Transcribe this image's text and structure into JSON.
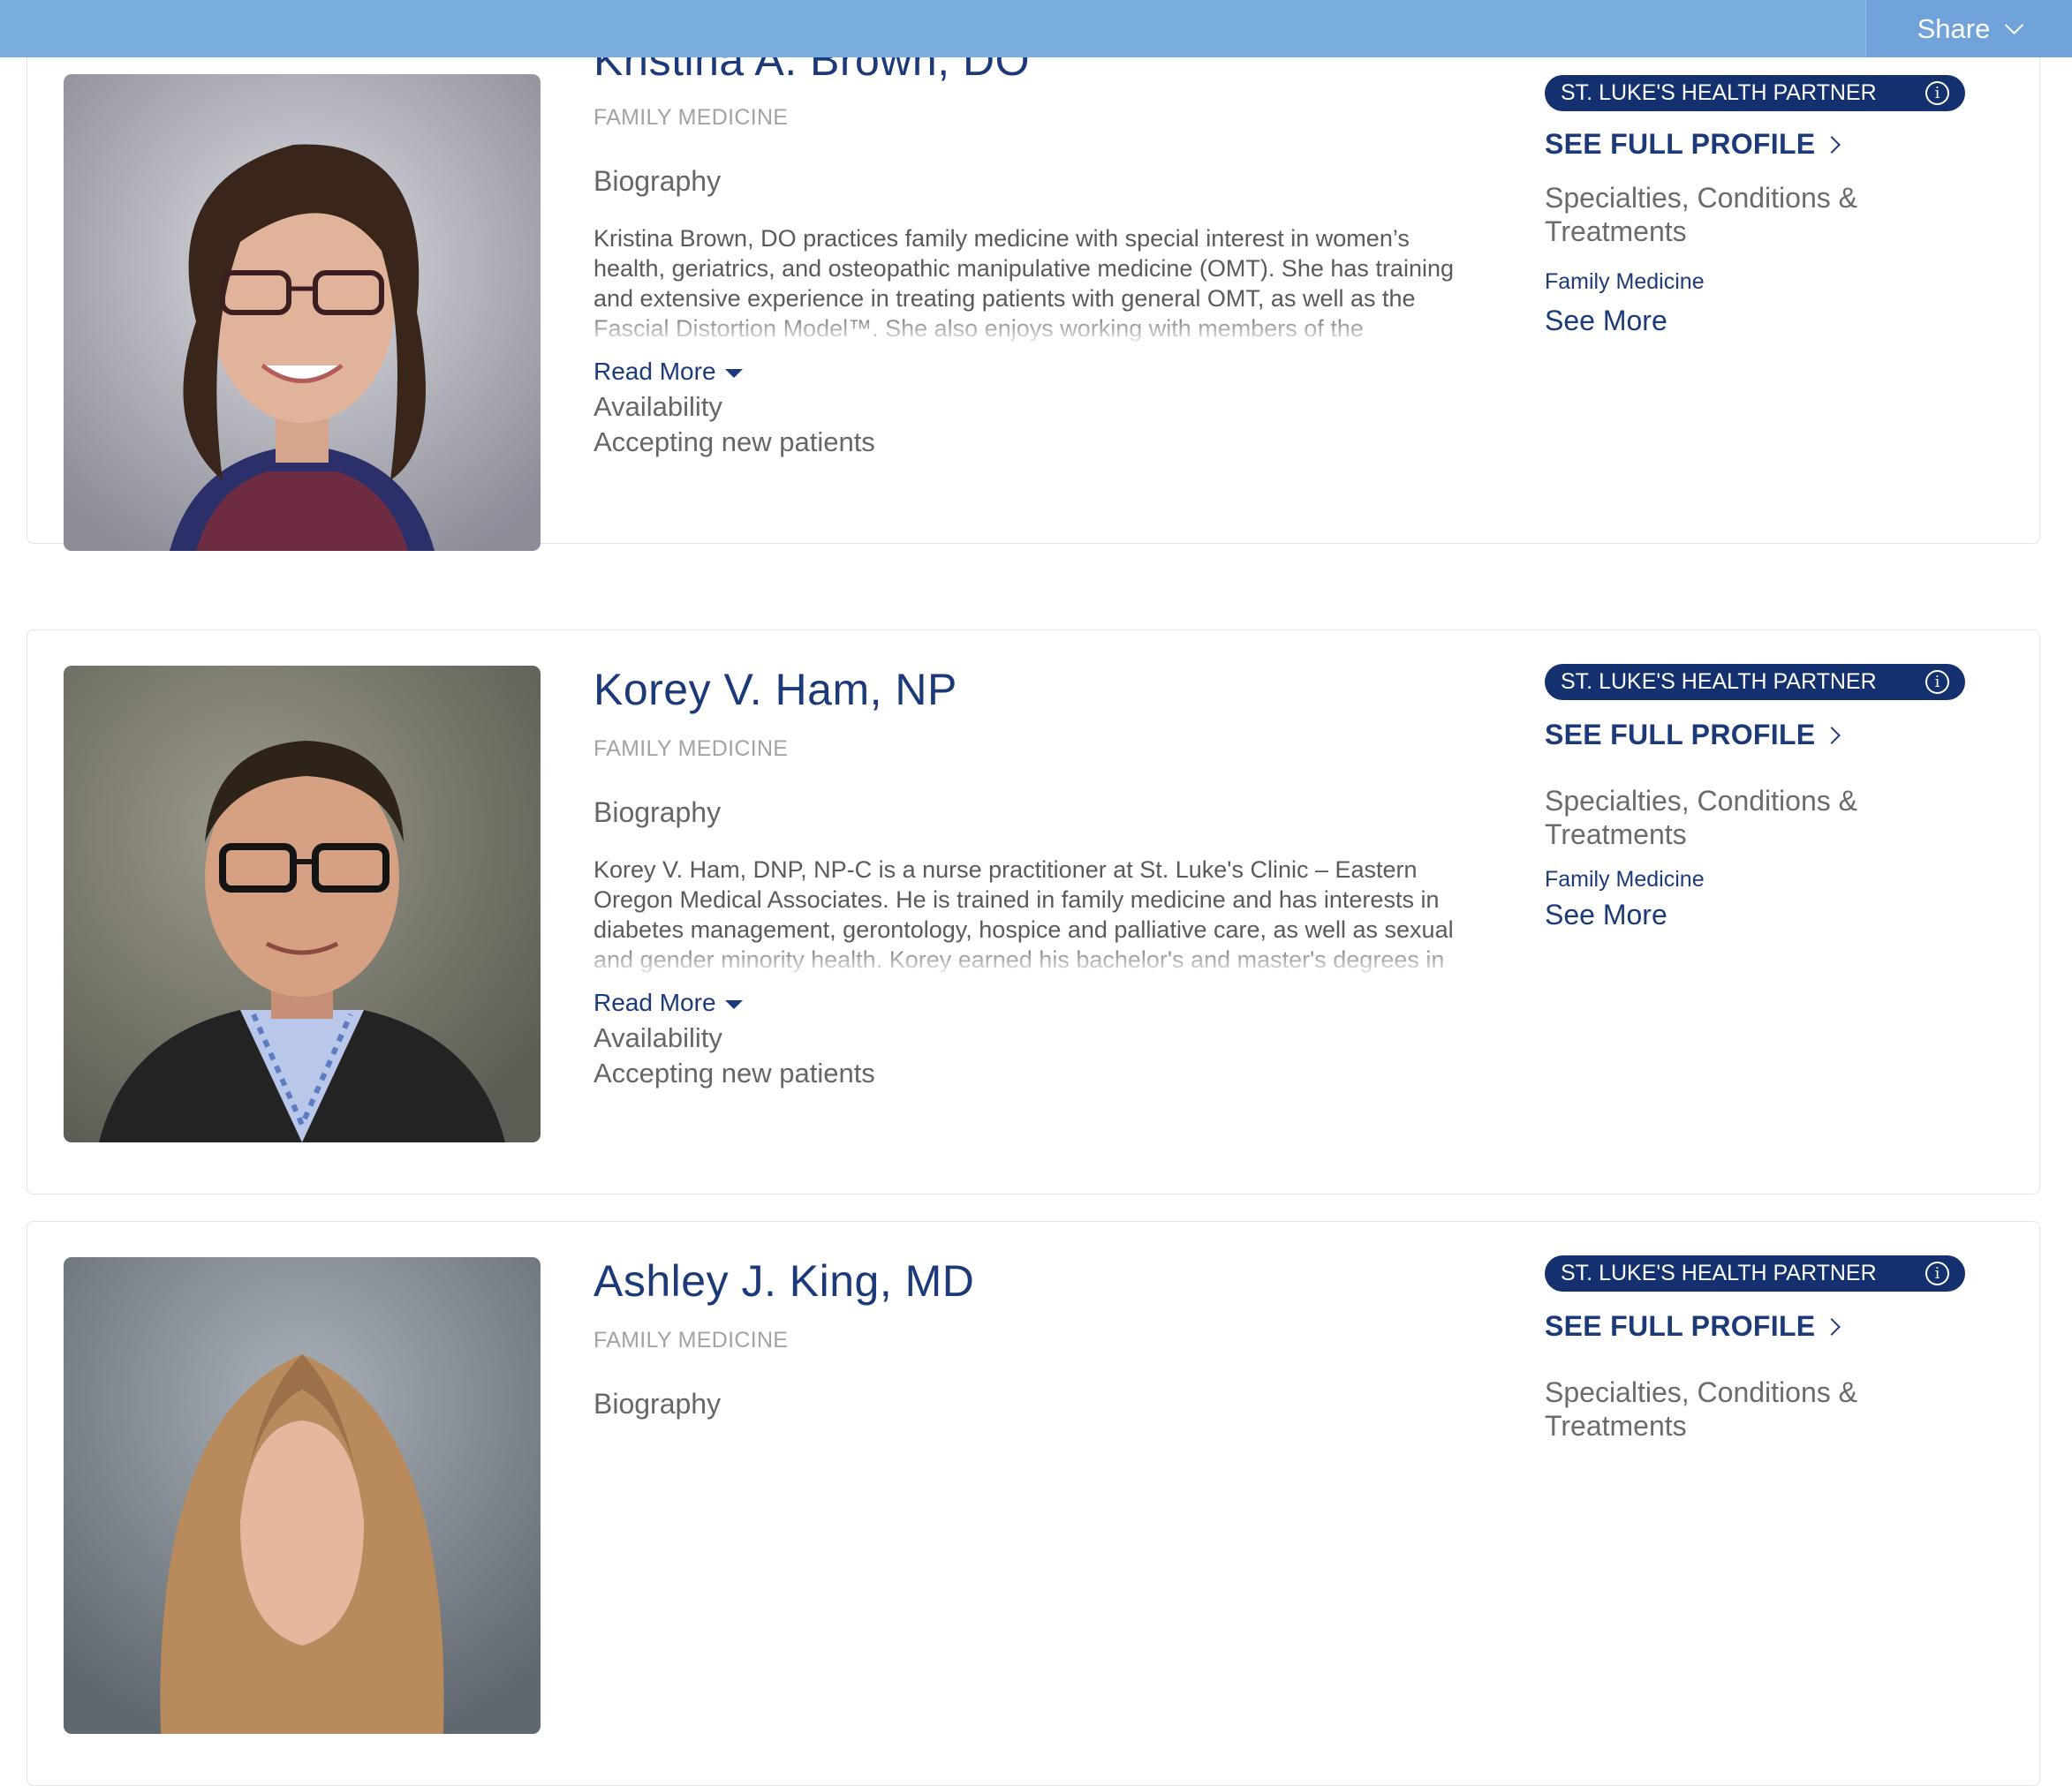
{
  "header": {
    "share_label": "Share"
  },
  "providers": [
    {
      "name": "Kristina A. Brown, DO",
      "specialty": "FAMILY MEDICINE",
      "bio_heading": "Biography",
      "bio_text": "Kristina Brown, DO practices family medicine with special interest in women’s health, geriatrics, and osteopathic manipulative medicine (OMT). She has training and extensive experience in treating patients with general OMT, as well as the Fascial Distortion Model™. She also enjoys working with members of the LGBTQIA+ community, and offers a safe space for gender",
      "read_more": "Read More",
      "availability_heading": "Availability",
      "availability_value": "Accepting new patients",
      "partner_badge": "ST. LUKE'S HEALTH PARTNER",
      "info_icon": "i",
      "full_profile": "SEE FULL PROFILE",
      "specialties_heading": "Specialties, Conditions & Treatments",
      "specialty_item": "Family Medicine",
      "see_more": "See More"
    },
    {
      "name": "Korey V. Ham, NP",
      "specialty": "FAMILY MEDICINE",
      "bio_heading": "Biography",
      "bio_text": "Korey V. Ham, DNP, NP-C is a nurse practitioner at St. Luke's Clinic – Eastern Oregon Medical Associates. He is trained in family medicine and has interests in diabetes management, gerontology, hospice and palliative care, as well as sexual and gender minority health. Korey earned his bachelor's and master's degrees in nursing, and his",
      "read_more": "Read More",
      "availability_heading": "Availability",
      "availability_value": "Accepting new patients",
      "partner_badge": "ST. LUKE'S HEALTH PARTNER",
      "info_icon": "i",
      "full_profile": "SEE FULL PROFILE",
      "specialties_heading": "Specialties, Conditions & Treatments",
      "specialty_item": "Family Medicine",
      "see_more": "See More"
    },
    {
      "name": "Ashley J. King, MD",
      "specialty": "FAMILY MEDICINE",
      "bio_heading": "Biography",
      "partner_badge": "ST. LUKE'S HEALTH PARTNER",
      "info_icon": "i",
      "full_profile": "SEE FULL PROFILE",
      "specialties_heading": "Specialties, Conditions & Treatments"
    }
  ]
}
